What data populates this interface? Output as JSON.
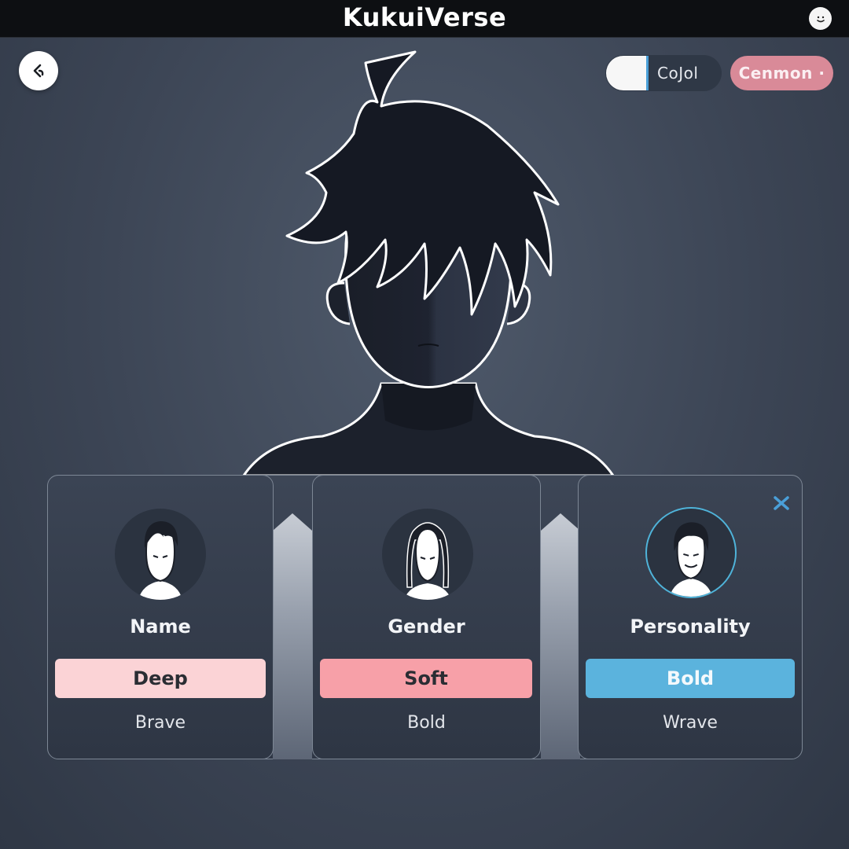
{
  "app": {
    "title": "KukuiVerse"
  },
  "header": {
    "profile_icon": "face-icon",
    "back_icon": "back-arrow-icon"
  },
  "controls": {
    "toggle_label": "CoJol",
    "pill_label": "Cenmon ·"
  },
  "colors": {
    "accent_blue": "#4a9fd8",
    "pink_soft": "#fbd3d6",
    "pink": "#f7a0a8",
    "blue": "#5bb3dd"
  },
  "cards": [
    {
      "label": "Name",
      "button": "Deep",
      "sub": "Brave"
    },
    {
      "label": "Gender",
      "button": "Soft",
      "sub": "Bold"
    },
    {
      "label": "Personality",
      "button": "Bold",
      "sub": "Wrave"
    }
  ]
}
